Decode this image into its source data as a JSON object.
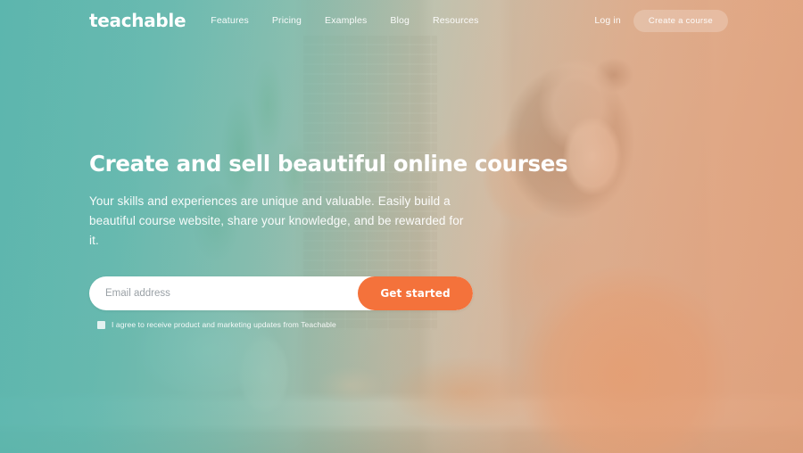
{
  "header": {
    "logo": "teachable",
    "nav": [
      {
        "label": "Features"
      },
      {
        "label": "Pricing"
      },
      {
        "label": "Examples"
      },
      {
        "label": "Blog"
      },
      {
        "label": "Resources"
      }
    ],
    "login_label": "Log in",
    "cta_label": "Create a course"
  },
  "hero": {
    "headline": "Create and sell beautiful online courses",
    "subheading": "Your skills and experiences are unique and valuable. Easily build a beautiful course website, share your knowledge, and be rewarded for it.",
    "form": {
      "email_placeholder": "Email address",
      "email_value": "",
      "submit_label": "Get started",
      "consent_label": "I agree to receive product and marketing updates from Teachable",
      "consent_checked": false
    }
  },
  "colors": {
    "accent_orange": "#f4723b",
    "duotone_teal": "#5cb7b0",
    "duotone_peach": "#e29e7a",
    "text_white": "#ffffff"
  },
  "background": {
    "description": "Photo of a woman wearing headphones working at a laptop with a plant and coffee cup on a desk, tinted with a teal-to-peach duotone gradient"
  }
}
